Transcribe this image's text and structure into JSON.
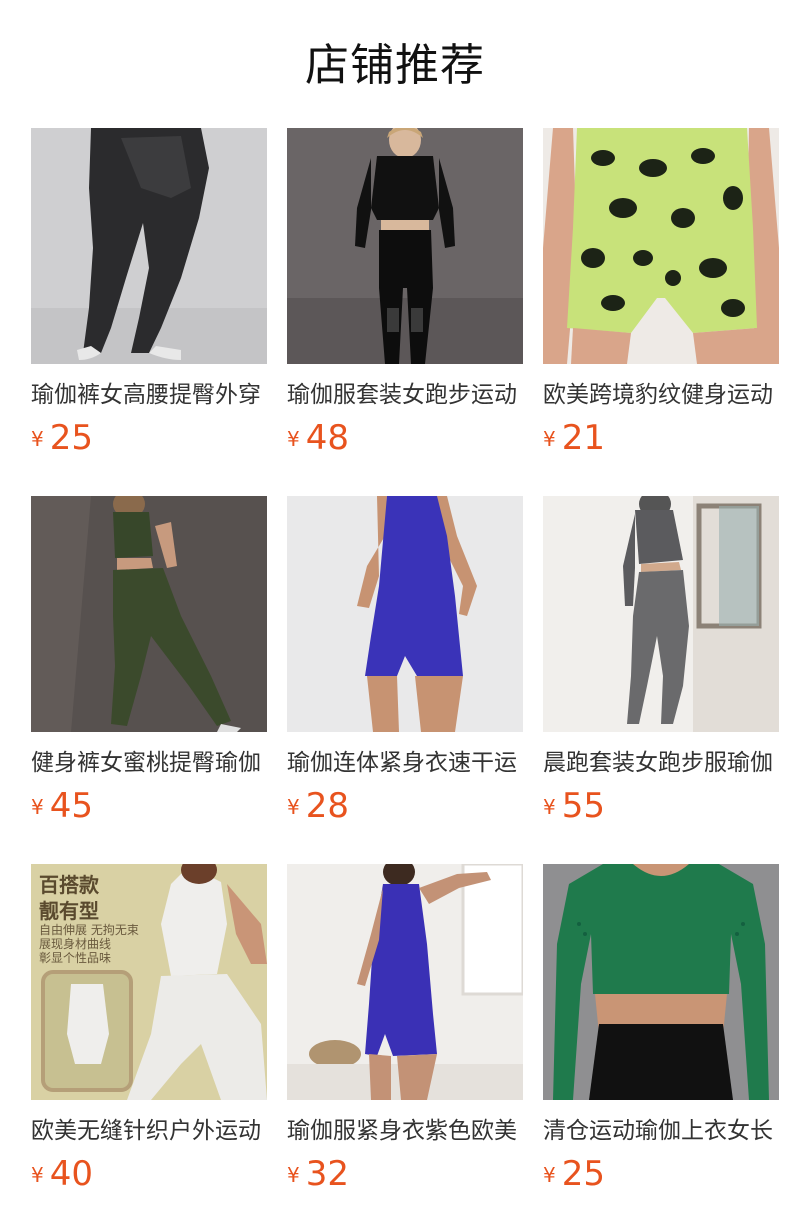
{
  "page": {
    "title": "店铺推荐"
  },
  "currency_symbol": "¥",
  "products": [
    {
      "name": "瑜伽裤女高腰提臀外穿",
      "price": "25",
      "image": "black-denim-leggings"
    },
    {
      "name": "瑜伽服套装女跑步运动",
      "price": "48",
      "image": "black-yoga-set"
    },
    {
      "name": "欧美跨境豹纹健身运动",
      "price": "21",
      "image": "leopard-shorts"
    },
    {
      "name": "健身裤女蜜桃提臀瑜伽",
      "price": "45",
      "image": "olive-leggings-set"
    },
    {
      "name": "瑜伽连体紧身衣速干运",
      "price": "28",
      "image": "blue-jumpsuit"
    },
    {
      "name": "晨跑套装女跑步服瑜伽",
      "price": "55",
      "image": "grey-hoodie-set"
    },
    {
      "name": "欧美无缝针织户外运动",
      "price": "40",
      "image": "white-set-promo"
    },
    {
      "name": "瑜伽服紧身衣紫色欧美",
      "price": "32",
      "image": "purple-jumpsuit"
    },
    {
      "name": "清仓运动瑜伽上衣女长",
      "price": "25",
      "image": "green-crop-top"
    }
  ],
  "promo": {
    "headline_1": "百搭款",
    "headline_2": "靓有型",
    "line_1": "自由伸展 无拘无束",
    "line_2": "展现身材曲线",
    "line_3": "彰显个性品味"
  },
  "colors": {
    "price": "#e8531e",
    "title": "#111111",
    "name": "#333333"
  }
}
